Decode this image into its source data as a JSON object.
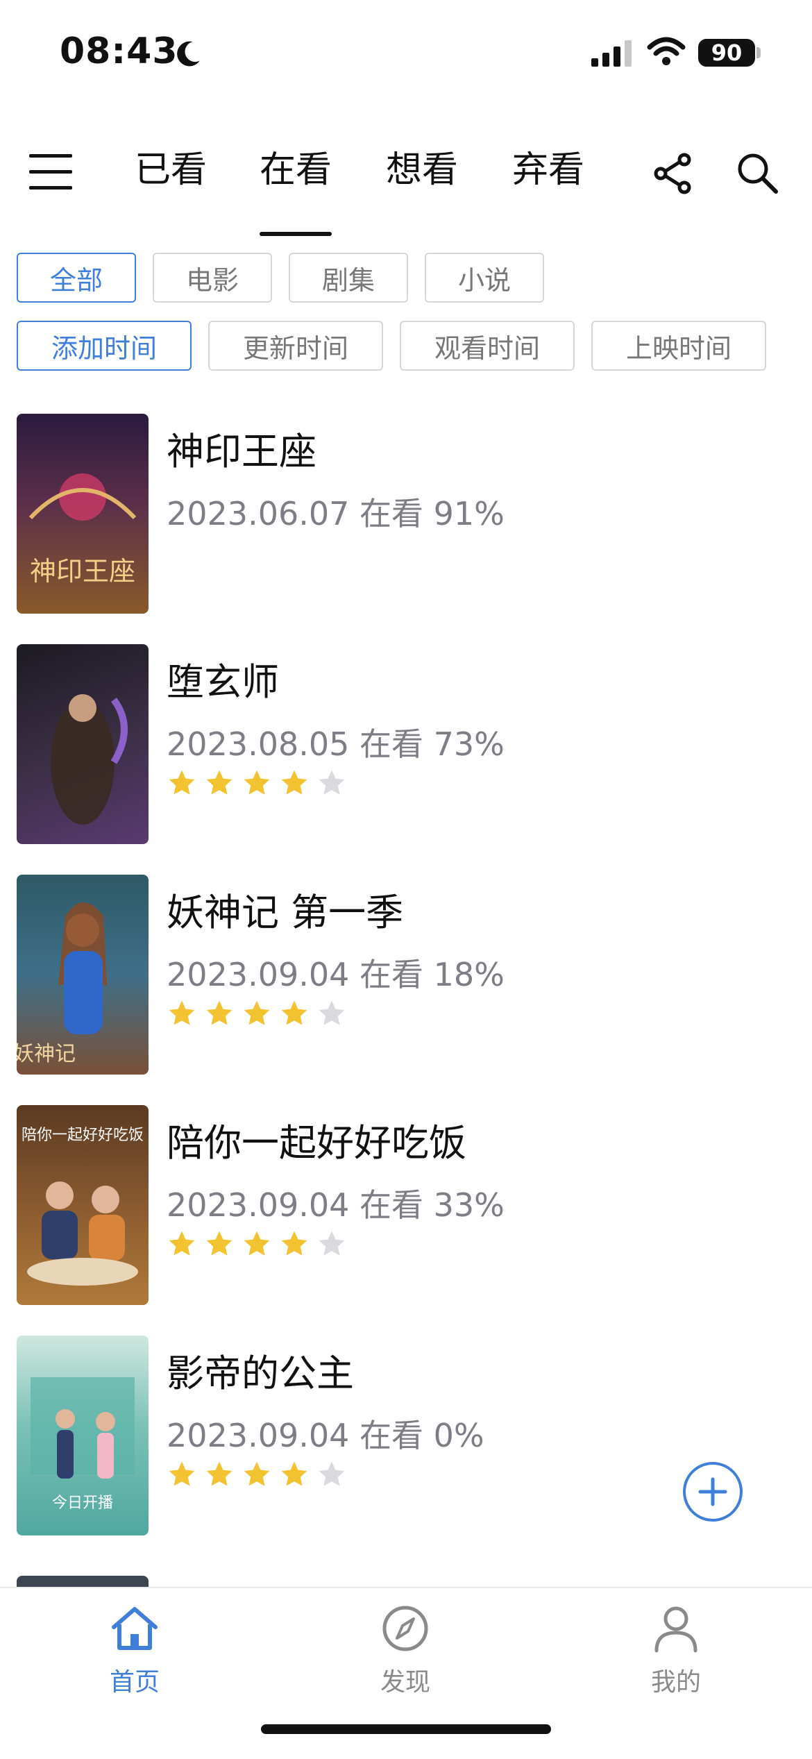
{
  "status_bar": {
    "time": "08:43",
    "battery": "90"
  },
  "top_tabs": [
    "已看",
    "在看",
    "想看",
    "弃看"
  ],
  "active_tab": "在看",
  "category_filters": [
    "全部",
    "电影",
    "剧集",
    "小说"
  ],
  "sort_options": [
    "添加时间",
    "更新时间",
    "观看时间",
    "上映时间"
  ],
  "items": [
    {
      "title": "神印王座",
      "meta": "2023.06.07 在看 91%",
      "rating": null,
      "poster_text": "神印王座",
      "poster_colors": [
        "#2a1a3e",
        "#8a5a2a"
      ]
    },
    {
      "title": "堕玄师",
      "meta": "2023.08.05 在看 73%",
      "rating": 4,
      "poster_text": "",
      "poster_colors": [
        "#1c1a22",
        "#5a3a70"
      ]
    },
    {
      "title": "妖神记 第一季",
      "meta": "2023.09.04 在看 18%",
      "rating": 4,
      "poster_text": "妖神记",
      "poster_colors": [
        "#2e5a66",
        "#7a5038"
      ]
    },
    {
      "title": "陪你一起好好吃饭",
      "meta": "2023.09.04 在看 33%",
      "rating": 4,
      "poster_text": "陪你一起好好吃饭",
      "poster_colors": [
        "#5a3a22",
        "#b07a3a"
      ]
    },
    {
      "title": "影帝的公主",
      "meta": "2023.09.04 在看 0%",
      "rating": 4,
      "poster_text": "今日开播",
      "poster_colors": [
        "#4fa8a0",
        "#cfe7e0"
      ]
    }
  ],
  "bottom_nav": [
    {
      "label": "首页",
      "icon": "home-icon",
      "active": true
    },
    {
      "label": "发现",
      "icon": "compass-icon",
      "active": false
    },
    {
      "label": "我的",
      "icon": "profile-icon",
      "active": false
    }
  ],
  "colors": {
    "accent": "#3f7fd9",
    "star": "#f2c230",
    "star_empty": "#d9d9de",
    "meta_text": "#7d7d86"
  }
}
